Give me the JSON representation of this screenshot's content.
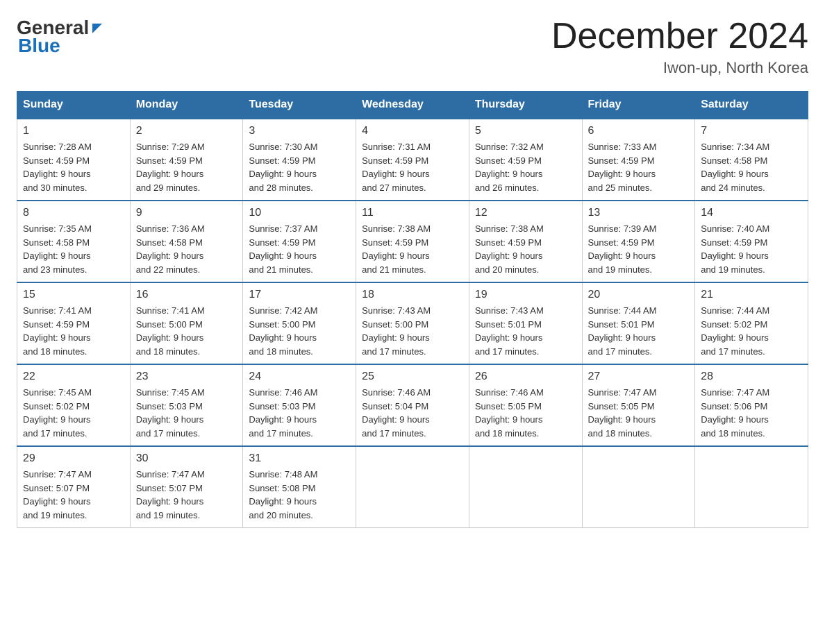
{
  "header": {
    "logo_line1": "General",
    "logo_line2": "Blue",
    "title": "December 2024",
    "subtitle": "Iwon-up, North Korea"
  },
  "days_of_week": [
    "Sunday",
    "Monday",
    "Tuesday",
    "Wednesday",
    "Thursday",
    "Friday",
    "Saturday"
  ],
  "weeks": [
    [
      {
        "num": "1",
        "sunrise": "7:28 AM",
        "sunset": "4:59 PM",
        "daylight": "9 hours and 30 minutes."
      },
      {
        "num": "2",
        "sunrise": "7:29 AM",
        "sunset": "4:59 PM",
        "daylight": "9 hours and 29 minutes."
      },
      {
        "num": "3",
        "sunrise": "7:30 AM",
        "sunset": "4:59 PM",
        "daylight": "9 hours and 28 minutes."
      },
      {
        "num": "4",
        "sunrise": "7:31 AM",
        "sunset": "4:59 PM",
        "daylight": "9 hours and 27 minutes."
      },
      {
        "num": "5",
        "sunrise": "7:32 AM",
        "sunset": "4:59 PM",
        "daylight": "9 hours and 26 minutes."
      },
      {
        "num": "6",
        "sunrise": "7:33 AM",
        "sunset": "4:59 PM",
        "daylight": "9 hours and 25 minutes."
      },
      {
        "num": "7",
        "sunrise": "7:34 AM",
        "sunset": "4:58 PM",
        "daylight": "9 hours and 24 minutes."
      }
    ],
    [
      {
        "num": "8",
        "sunrise": "7:35 AM",
        "sunset": "4:58 PM",
        "daylight": "9 hours and 23 minutes."
      },
      {
        "num": "9",
        "sunrise": "7:36 AM",
        "sunset": "4:58 PM",
        "daylight": "9 hours and 22 minutes."
      },
      {
        "num": "10",
        "sunrise": "7:37 AM",
        "sunset": "4:59 PM",
        "daylight": "9 hours and 21 minutes."
      },
      {
        "num": "11",
        "sunrise": "7:38 AM",
        "sunset": "4:59 PM",
        "daylight": "9 hours and 21 minutes."
      },
      {
        "num": "12",
        "sunrise": "7:38 AM",
        "sunset": "4:59 PM",
        "daylight": "9 hours and 20 minutes."
      },
      {
        "num": "13",
        "sunrise": "7:39 AM",
        "sunset": "4:59 PM",
        "daylight": "9 hours and 19 minutes."
      },
      {
        "num": "14",
        "sunrise": "7:40 AM",
        "sunset": "4:59 PM",
        "daylight": "9 hours and 19 minutes."
      }
    ],
    [
      {
        "num": "15",
        "sunrise": "7:41 AM",
        "sunset": "4:59 PM",
        "daylight": "9 hours and 18 minutes."
      },
      {
        "num": "16",
        "sunrise": "7:41 AM",
        "sunset": "5:00 PM",
        "daylight": "9 hours and 18 minutes."
      },
      {
        "num": "17",
        "sunrise": "7:42 AM",
        "sunset": "5:00 PM",
        "daylight": "9 hours and 18 minutes."
      },
      {
        "num": "18",
        "sunrise": "7:43 AM",
        "sunset": "5:00 PM",
        "daylight": "9 hours and 17 minutes."
      },
      {
        "num": "19",
        "sunrise": "7:43 AM",
        "sunset": "5:01 PM",
        "daylight": "9 hours and 17 minutes."
      },
      {
        "num": "20",
        "sunrise": "7:44 AM",
        "sunset": "5:01 PM",
        "daylight": "9 hours and 17 minutes."
      },
      {
        "num": "21",
        "sunrise": "7:44 AM",
        "sunset": "5:02 PM",
        "daylight": "9 hours and 17 minutes."
      }
    ],
    [
      {
        "num": "22",
        "sunrise": "7:45 AM",
        "sunset": "5:02 PM",
        "daylight": "9 hours and 17 minutes."
      },
      {
        "num": "23",
        "sunrise": "7:45 AM",
        "sunset": "5:03 PM",
        "daylight": "9 hours and 17 minutes."
      },
      {
        "num": "24",
        "sunrise": "7:46 AM",
        "sunset": "5:03 PM",
        "daylight": "9 hours and 17 minutes."
      },
      {
        "num": "25",
        "sunrise": "7:46 AM",
        "sunset": "5:04 PM",
        "daylight": "9 hours and 17 minutes."
      },
      {
        "num": "26",
        "sunrise": "7:46 AM",
        "sunset": "5:05 PM",
        "daylight": "9 hours and 18 minutes."
      },
      {
        "num": "27",
        "sunrise": "7:47 AM",
        "sunset": "5:05 PM",
        "daylight": "9 hours and 18 minutes."
      },
      {
        "num": "28",
        "sunrise": "7:47 AM",
        "sunset": "5:06 PM",
        "daylight": "9 hours and 18 minutes."
      }
    ],
    [
      {
        "num": "29",
        "sunrise": "7:47 AM",
        "sunset": "5:07 PM",
        "daylight": "9 hours and 19 minutes."
      },
      {
        "num": "30",
        "sunrise": "7:47 AM",
        "sunset": "5:07 PM",
        "daylight": "9 hours and 19 minutes."
      },
      {
        "num": "31",
        "sunrise": "7:48 AM",
        "sunset": "5:08 PM",
        "daylight": "9 hours and 20 minutes."
      },
      null,
      null,
      null,
      null
    ]
  ],
  "labels": {
    "sunrise": "Sunrise:",
    "sunset": "Sunset:",
    "daylight": "Daylight:"
  }
}
